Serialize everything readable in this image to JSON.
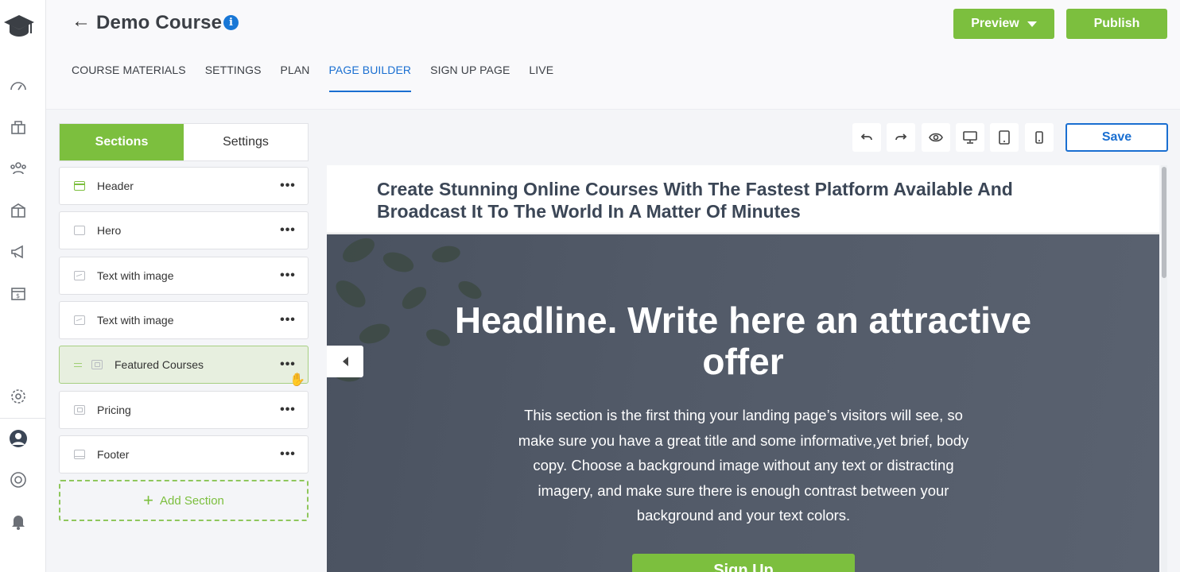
{
  "header": {
    "course_title": "Demo Course",
    "preview_label": "Preview",
    "publish_label": "Publish",
    "tabs": [
      "COURSE MATERIALS",
      "SETTINGS",
      "PLAN",
      "PAGE BUILDER",
      "SIGN UP PAGE",
      "LIVE"
    ],
    "active_tab": "PAGE BUILDER"
  },
  "rail": {
    "icons": [
      "graduation-cap-logo",
      "dashboard-icon",
      "courses-icon",
      "users-icon",
      "products-icon",
      "marketing-icon",
      "sales-icon",
      "settings-icon",
      "profile-icon",
      "help-icon",
      "notifications-icon"
    ]
  },
  "panel": {
    "tab_sections": "Sections",
    "tab_settings": "Settings",
    "sections": [
      {
        "label": "Header"
      },
      {
        "label": "Hero"
      },
      {
        "label": "Text with image"
      },
      {
        "label": "Text with image"
      },
      {
        "label": "Featured Courses"
      },
      {
        "label": "Pricing"
      },
      {
        "label": "Footer"
      }
    ],
    "more": "•••",
    "add_section": "Add Section"
  },
  "toolbar": {
    "save_label": "Save",
    "tools": [
      "undo-icon",
      "redo-icon",
      "eye-icon",
      "desktop-icon",
      "tablet-icon",
      "mobile-icon"
    ]
  },
  "canvas": {
    "page_title": "Create Stunning Online Courses With The Fastest Platform Available And Broadcast It To The World In A Matter Of Minutes",
    "hero_headline": "Headline. Write here an attractive offer",
    "hero_body": "This section is the first thing your landing page’s visitors will see, so make sure you have a great title and some informative,yet brief, body copy. Choose a background image without any text or distracting imagery, and make sure there is enough contrast between your background and your text colors.",
    "cta_label": "Sign Up"
  },
  "colors": {
    "accent_green": "#7cbf3e",
    "accent_blue": "#1a6fd1"
  }
}
